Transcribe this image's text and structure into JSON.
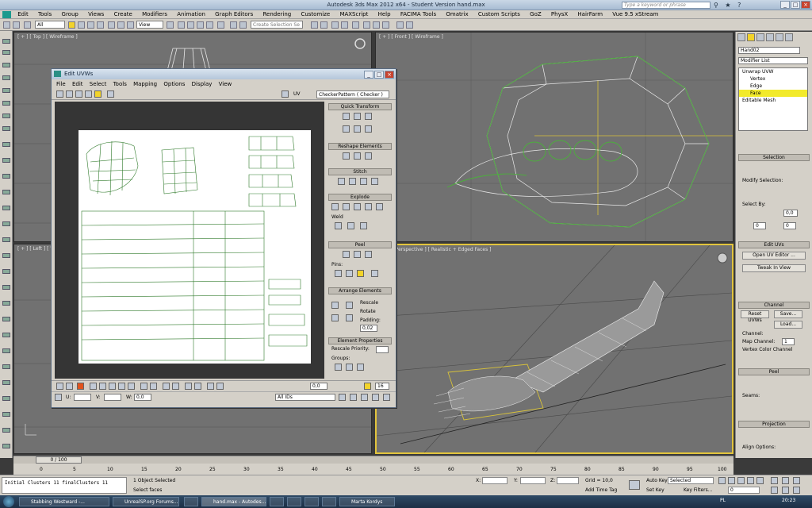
{
  "app": {
    "title": "Autodesk 3ds Max  2012 x64  - Student Version   hand.max",
    "search_placeholder": "Type a keyword or phrase"
  },
  "menu": [
    "Edit",
    "Tools",
    "Group",
    "Views",
    "Create",
    "Modifiers",
    "Animation",
    "Graph Editors",
    "Rendering",
    "Customize",
    "MAXScript",
    "Help",
    "FACIMA Tools",
    "Omatrix",
    "Custom Scripts",
    "GoZ",
    "PhysX",
    "HairFarm",
    "Vue 9.5 xStream"
  ],
  "toolbar": {
    "filter_value": "All",
    "refcoord_value": "View",
    "selection_set_placeholder": "Create Selection Se"
  },
  "viewports": {
    "top": "[ + ] [ Top ] [ Wireframe ]",
    "front": "[ + ] [ Front ] [ Wireframe ]",
    "left": "[ + ] [ Left ] [ Wireframe ]",
    "persp": "[ + ] [ Perspective ] [ Realistic + Edged Faces ]"
  },
  "uv_editor": {
    "title": "Edit UVWs",
    "menu": [
      "File",
      "Edit",
      "Select",
      "Tools",
      "Mapping",
      "Options",
      "Display",
      "View"
    ],
    "uv_label": "UV",
    "texture_select": "CheckerPattern  ( Checker )",
    "sections": {
      "quick_transform": "Quick Transform",
      "reshape": "Reshape Elements",
      "stitch": "Stitch",
      "explode": "Explode",
      "weld": "Weld",
      "peel": "Peel",
      "pins": "Pins:",
      "arrange": "Arrange Elements",
      "rescale": "Rescale",
      "rotate": "Rotate",
      "padding_label": "Padding:",
      "padding_value": "0,02",
      "element_props": "Element Properties",
      "rescale_priority": "Rescale Priority:",
      "groups": "Groups:"
    },
    "bottom": {
      "soft_value": "0,0",
      "u_label": "U:",
      "v_label": "V:",
      "w_label": "W:",
      "w_value": "0,0",
      "ids_value": "All IDs",
      "zoom_value": "16"
    }
  },
  "command_panel": {
    "object_name": "Hand02",
    "modifier_list": "Modifier List",
    "stack": [
      "Unwrap UVW",
      "Vertex",
      "Edge",
      "Face",
      "Editable Mesh"
    ],
    "selection_header": "Selection",
    "modify_selection": "Modify Selection:",
    "select_by": "Select By:",
    "select_value_1": "0,0",
    "select_value_2": "0",
    "select_value_3": "0",
    "edit_uvs_header": "Edit UVs",
    "open_uv_editor": "Open UV Editor ...",
    "tweak_in_view": "Tweak In View",
    "channel_header": "Channel",
    "reset_uvws": "Reset UVWs",
    "save": "Save...",
    "load": "Load...",
    "channel_label": "Channel:",
    "map_channel": "Map Channel:",
    "map_channel_value": "1",
    "vertex_color_channel": "Vertex Color Channel",
    "peel_header": "Peel",
    "seams": "Seams:",
    "projection_header": "Projection",
    "align_options": "Align Options:"
  },
  "timeline": {
    "frame": "0 / 100",
    "ticks": [
      "0",
      "5",
      "10",
      "15",
      "20",
      "25",
      "30",
      "35",
      "40",
      "45",
      "50",
      "55",
      "60",
      "65",
      "70",
      "75",
      "80",
      "85",
      "90",
      "95",
      "100"
    ]
  },
  "status": {
    "maxscript_line": "Initial Clusters 11 finalClusters 11",
    "selected": "1 Object Selected",
    "prompt": "Select faces",
    "x_label": "X:",
    "y_label": "Y:",
    "z_label": "Z:",
    "grid": "Grid = 10,0",
    "add_time_tag": "Add Time Tag",
    "auto_key": "Auto Key",
    "set_key": "Set Key",
    "key_mode": "Selected",
    "key_filters": "Key Filters...",
    "frame_value": "0"
  },
  "taskbar": {
    "items": [
      "Stabbing Westward -...",
      "UnrealSP.org Forums...",
      "hand.max - Autodes...",
      "Marta Kordys"
    ],
    "lang": "PL",
    "clock": "20:23"
  },
  "colors": {
    "accent_yellow": "#f2d32a",
    "viewport_gray": "#717171",
    "wire_white": "#ffffff",
    "seam_green": "#4caf3c"
  }
}
